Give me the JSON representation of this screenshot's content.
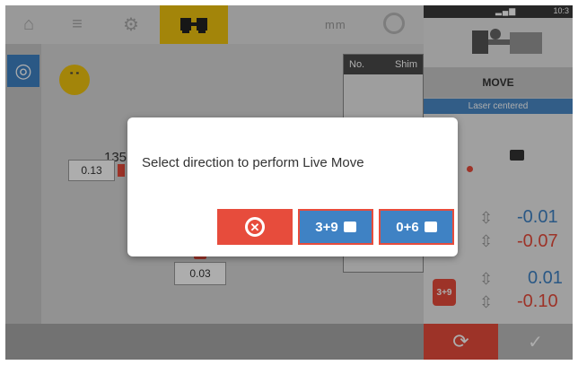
{
  "topbar": {
    "units_label": "mm"
  },
  "statusbar": {
    "time": "10:3"
  },
  "right_panel": {
    "move_title": "MOVE",
    "laser_status": "Laser centered",
    "angle_readout": "135.0",
    "values": [
      {
        "text": "-0.01",
        "color": "#3f82c4"
      },
      {
        "text": "-0.07",
        "color": "#e74c3c"
      },
      {
        "text": "0.01",
        "color": "#3f82c4"
      },
      {
        "text": "-0.10",
        "color": "#e74c3c"
      }
    ],
    "badge": "3+9"
  },
  "shim_table": {
    "col_no": "No.",
    "col_shim": "Shim"
  },
  "canvas": {
    "left_value": "0.13",
    "bottom_value": "0.03"
  },
  "dialog": {
    "message": "Select direction to perform Live Move",
    "cancel_icon": "cancel-icon",
    "btn_39_label": "3+9",
    "btn_06_label": "0+6"
  }
}
